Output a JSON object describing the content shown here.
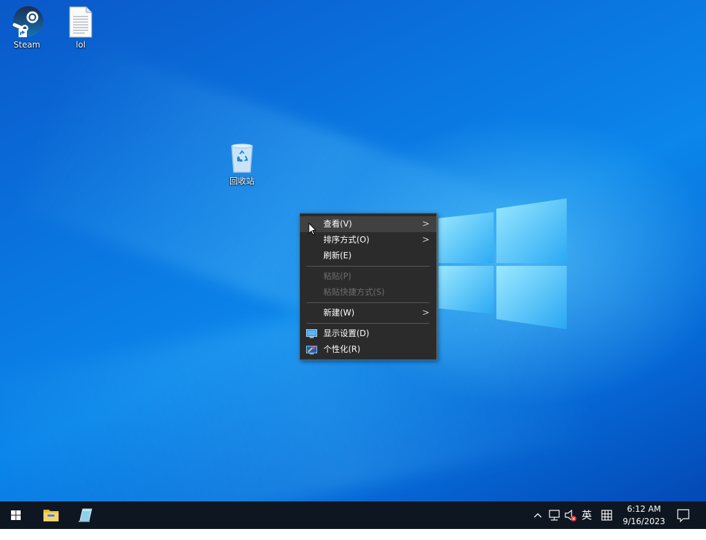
{
  "desktop": {
    "icons": [
      {
        "label": "Steam",
        "icon": "steam-icon"
      },
      {
        "label": "lol",
        "icon": "text-file-icon"
      },
      {
        "label": "回收站",
        "icon": "recycle-bin-icon"
      }
    ]
  },
  "context_menu": {
    "items": [
      {
        "label": "查看(V)",
        "has_submenu": true,
        "enabled": true,
        "hovered": true
      },
      {
        "label": "排序方式(O)",
        "has_submenu": true,
        "enabled": true
      },
      {
        "label": "刷新(E)",
        "enabled": true
      },
      {
        "label": "粘贴(P)",
        "enabled": false
      },
      {
        "label": "粘贴快捷方式(S)",
        "enabled": false
      },
      {
        "label": "新建(W)",
        "has_submenu": true,
        "enabled": true
      },
      {
        "label": "显示设置(D)",
        "icon": "display-settings-icon",
        "enabled": true
      },
      {
        "label": "个性化(R)",
        "icon": "personalize-icon",
        "enabled": true
      }
    ],
    "submenu_arrow": ">"
  },
  "taskbar": {
    "start_icon": "windows-start-icon",
    "pinned": [
      "file-explorer-icon",
      "notepad-icon"
    ],
    "tray": {
      "chevron": "^",
      "network_icon": "network-icon",
      "volume_icon": "volume-muted-icon",
      "ime_label": "英",
      "ime_mode_icon": "ime-grid-icon"
    },
    "clock": {
      "time": "6:12 AM",
      "date": "9/16/2023"
    },
    "notification_icon": "action-center-icon"
  },
  "colors": {
    "taskbar_bg": "#0e1621",
    "menu_bg": "#2b2b2b",
    "menu_hover": "#414141",
    "menu_disabled_text": "#6d6d6d",
    "desktop_accent": "#0a76e0"
  }
}
